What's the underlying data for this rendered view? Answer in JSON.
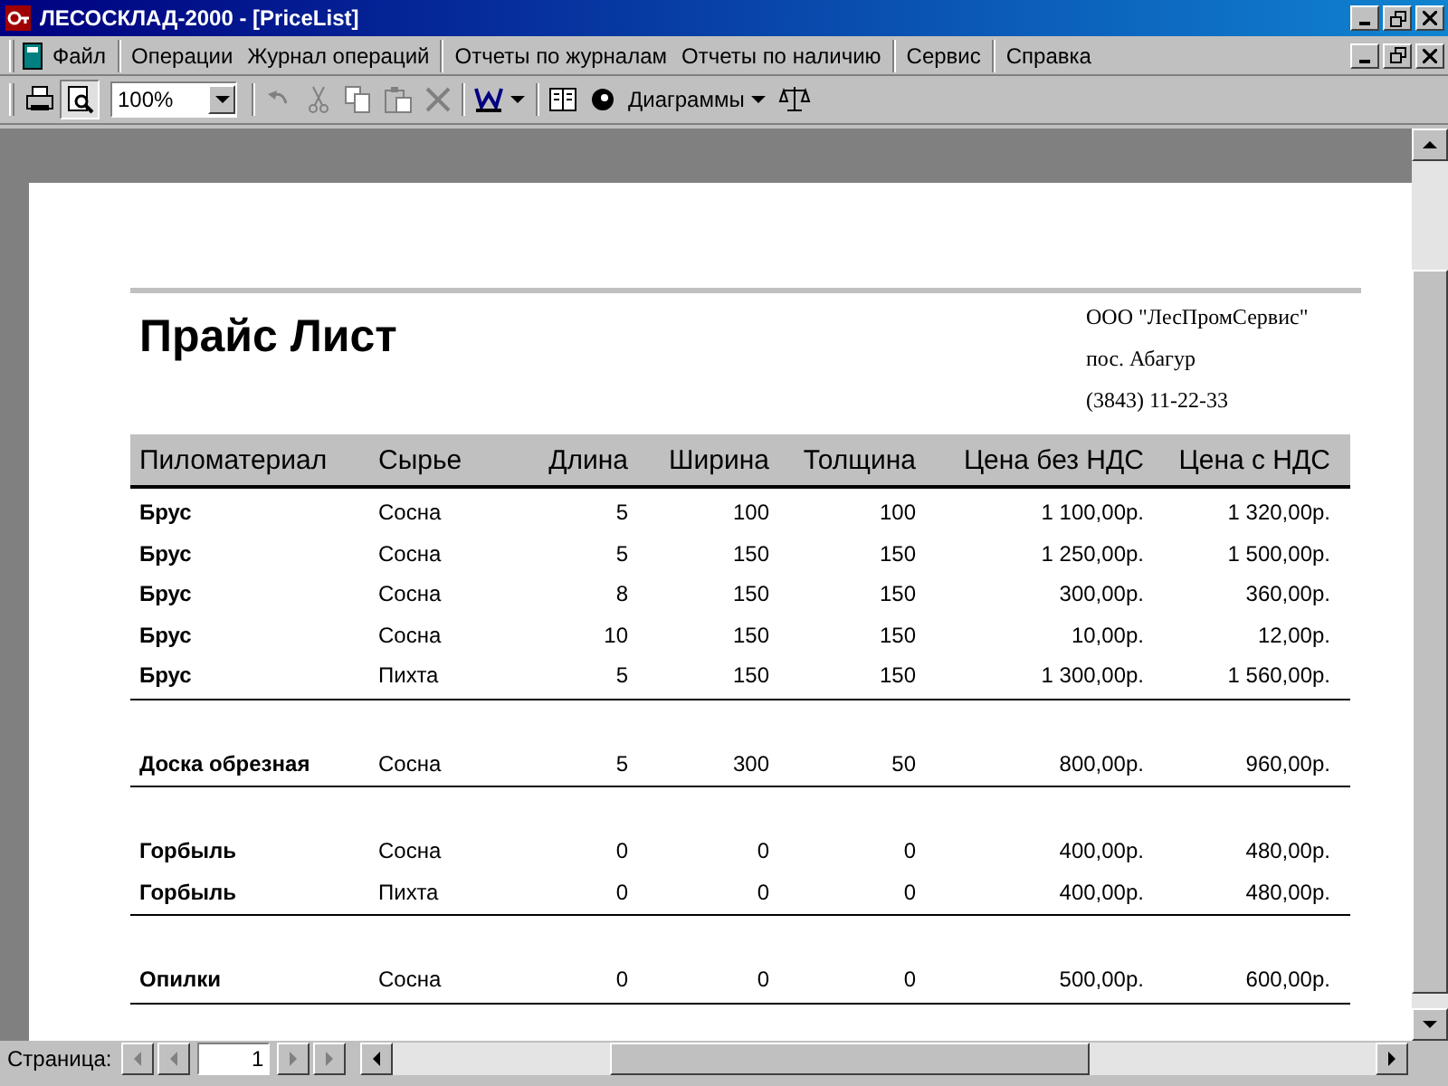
{
  "window": {
    "title": "ЛЕСОСКЛАД-2000 - [PriceList]"
  },
  "menu": [
    {
      "label": "Файл",
      "separator_before": false
    },
    {
      "label": "Операции",
      "separator_before": true
    },
    {
      "label": "Журнал операций",
      "separator_before": false
    },
    {
      "label": "Отчеты по журналам",
      "separator_before": true
    },
    {
      "label": "Отчеты по наличию",
      "separator_before": false
    },
    {
      "label": "Сервис",
      "separator_before": true
    },
    {
      "label": "Справка",
      "separator_before": true
    }
  ],
  "toolbar": {
    "buttons": [
      {
        "pressed": false,
        "disabled": false
      },
      {
        "pressed": true,
        "disabled": false
      }
    ],
    "zoom": "100%",
    "edit_buttons": [
      {
        "disabled": true
      },
      {
        "disabled": true
      },
      {
        "disabled": true
      },
      {
        "disabled": true
      },
      {
        "disabled": true
      }
    ],
    "charts": "Диаграммы"
  },
  "report": {
    "title": "Прайс Лист",
    "company": [
      "ООО \"ЛесПромСервис\"",
      "пос. Абагур",
      "(3843) 11-22-33"
    ],
    "columns": [
      "Пиломатериал",
      "Сырье",
      "Длина",
      "Ширина",
      "Толщина",
      "Цена без НДС",
      "Цена с НДС"
    ],
    "groups": [
      {
        "rows": [
          [
            "Брус",
            "Сосна",
            "5",
            "100",
            "100",
            "1 100,00р.",
            "1 320,00р."
          ],
          [
            "Брус",
            "Сосна",
            "5",
            "150",
            "150",
            "1 250,00р.",
            "1 500,00р."
          ],
          [
            "Брус",
            "Сосна",
            "8",
            "150",
            "150",
            "300,00р.",
            "360,00р."
          ],
          [
            "Брус",
            "Сосна",
            "10",
            "150",
            "150",
            "10,00р.",
            "12,00р."
          ],
          [
            "Брус",
            "Пихта",
            "5",
            "150",
            "150",
            "1 300,00р.",
            "1 560,00р."
          ]
        ]
      },
      {
        "rows": [
          [
            "Доска обрезная",
            "Сосна",
            "5",
            "300",
            "50",
            "800,00р.",
            "960,00р."
          ]
        ]
      },
      {
        "rows": [
          [
            "Горбыль",
            "Сосна",
            "0",
            "0",
            "0",
            "400,00р.",
            "480,00р."
          ],
          [
            "Горбыль",
            "Пихта",
            "0",
            "0",
            "0",
            "400,00р.",
            "480,00р."
          ]
        ]
      },
      {
        "rows": [
          [
            "Опилки",
            "Сосна",
            "0",
            "0",
            "0",
            "500,00р.",
            "600,00р."
          ]
        ]
      }
    ]
  },
  "navigation": {
    "label": "Страница:",
    "page": "1"
  }
}
